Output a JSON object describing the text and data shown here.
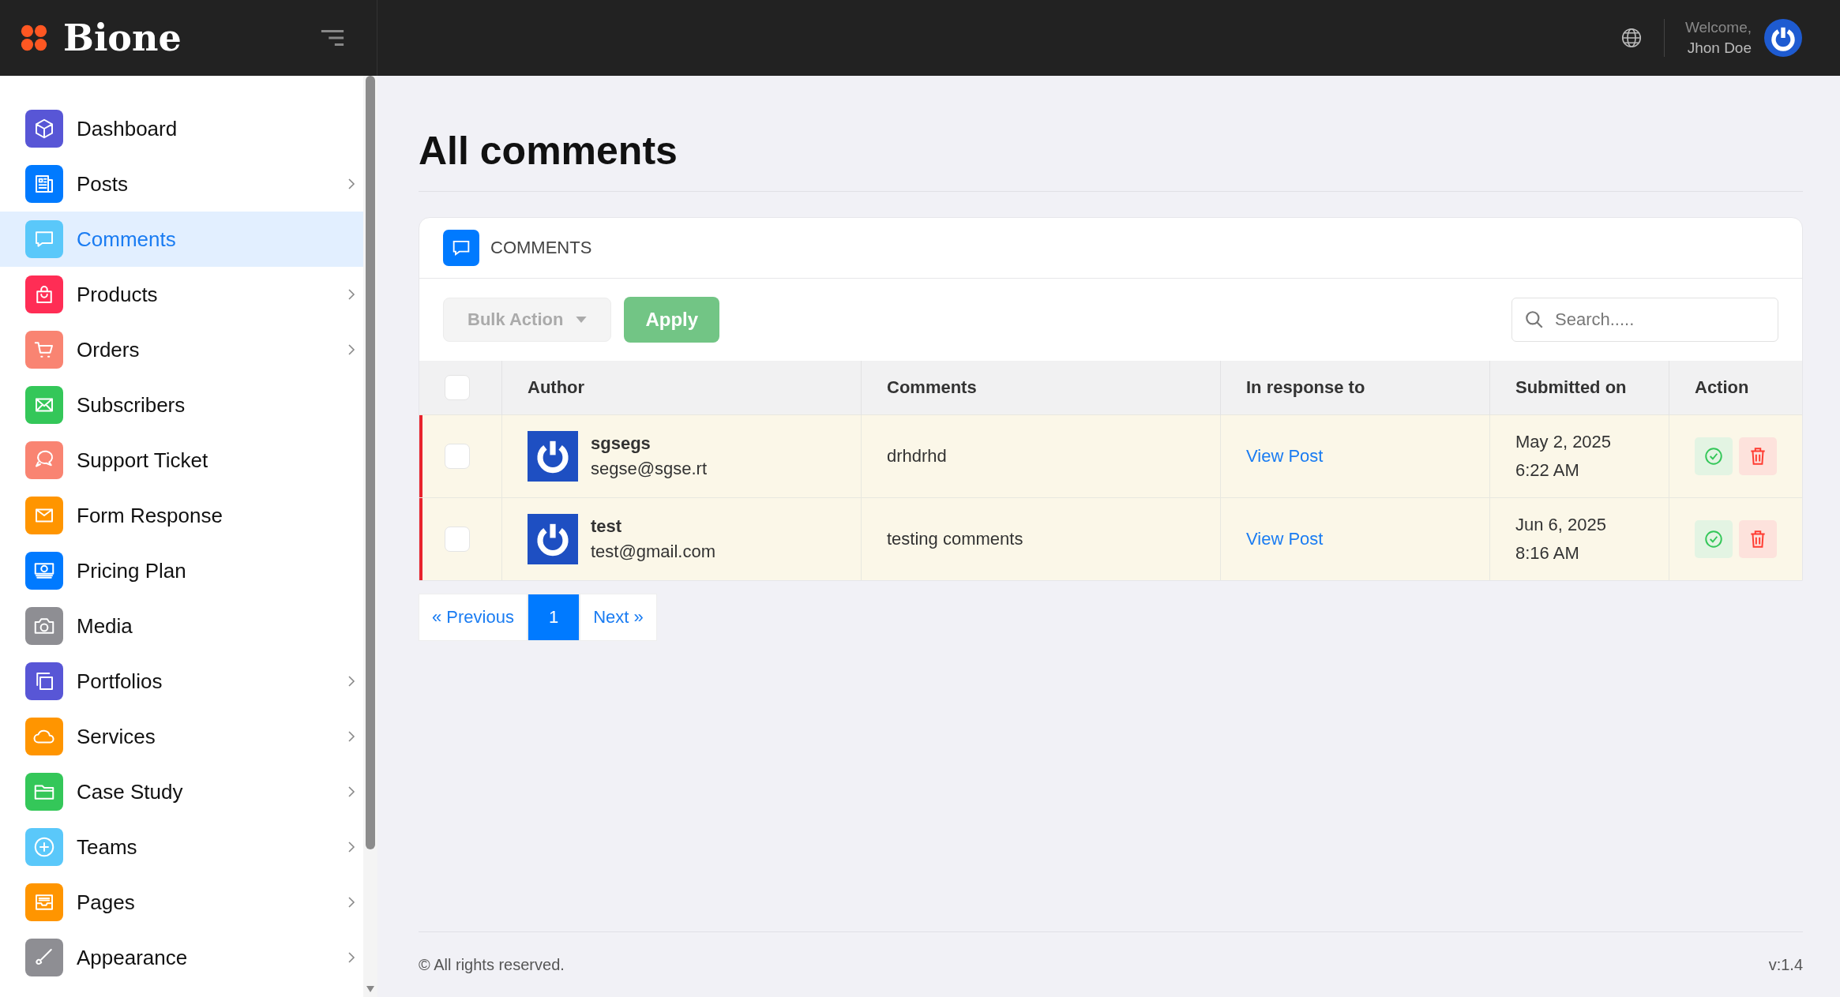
{
  "brand": {
    "name": "Bione"
  },
  "header": {
    "welcome": "Welcome,",
    "user": "Jhon Doe"
  },
  "sidebar": {
    "items": [
      {
        "label": "Dashboard",
        "color": "#5856d6",
        "submenu": false,
        "selected": false
      },
      {
        "label": "Posts",
        "color": "#007aff",
        "submenu": true,
        "selected": false
      },
      {
        "label": "Comments",
        "color": "#5ac8fa",
        "submenu": false,
        "selected": true
      },
      {
        "label": "Products",
        "color": "#ff2d55",
        "submenu": true,
        "selected": false
      },
      {
        "label": "Orders",
        "color": "#f98472",
        "submenu": true,
        "selected": false
      },
      {
        "label": "Subscribers",
        "color": "#34c759",
        "submenu": false,
        "selected": false
      },
      {
        "label": "Support Ticket",
        "color": "#f98472",
        "submenu": false,
        "selected": false
      },
      {
        "label": "Form Response",
        "color": "#ff9500",
        "submenu": false,
        "selected": false
      },
      {
        "label": "Pricing Plan",
        "color": "#007aff",
        "submenu": false,
        "selected": false
      },
      {
        "label": "Media",
        "color": "#8e8e93",
        "submenu": false,
        "selected": false
      },
      {
        "label": "Portfolios",
        "color": "#5856d6",
        "submenu": true,
        "selected": false
      },
      {
        "label": "Services",
        "color": "#ff9500",
        "submenu": true,
        "selected": false
      },
      {
        "label": "Case Study",
        "color": "#34c759",
        "submenu": true,
        "selected": false
      },
      {
        "label": "Teams",
        "color": "#5ac8fa",
        "submenu": true,
        "selected": false
      },
      {
        "label": "Pages",
        "color": "#ff9500",
        "submenu": true,
        "selected": false
      },
      {
        "label": "Appearance",
        "color": "#8e8e93",
        "submenu": true,
        "selected": false
      }
    ]
  },
  "page": {
    "title": "All comments"
  },
  "card": {
    "title": "COMMENTS"
  },
  "toolbar": {
    "bulk_action": "Bulk Action",
    "apply": "Apply",
    "search": {
      "placeholder": "Search....."
    }
  },
  "table": {
    "select_all": {
      "checked": false
    },
    "columns": [
      "Author",
      "Comments",
      "In response to",
      "Submitted on",
      "Action"
    ],
    "rows": [
      {
        "checked": false,
        "pending": true,
        "name": "sgsegs",
        "email": "segse@sgse.rt",
        "comment": "drhdrhd",
        "link": "View Post",
        "date": "May 2, 2025",
        "time": "6:22 AM"
      },
      {
        "checked": false,
        "pending": true,
        "name": "test",
        "email": "test@gmail.com",
        "comment": "testing comments",
        "link": "View Post",
        "date": "Jun 6, 2025",
        "time": "8:16 AM"
      }
    ]
  },
  "pagination": {
    "previous": "« Previous",
    "pages": [
      {
        "label": "1",
        "selected": true
      }
    ],
    "next": "Next »"
  },
  "footer": {
    "copyright": "© All rights reserved.",
    "version": "v:1.4"
  }
}
